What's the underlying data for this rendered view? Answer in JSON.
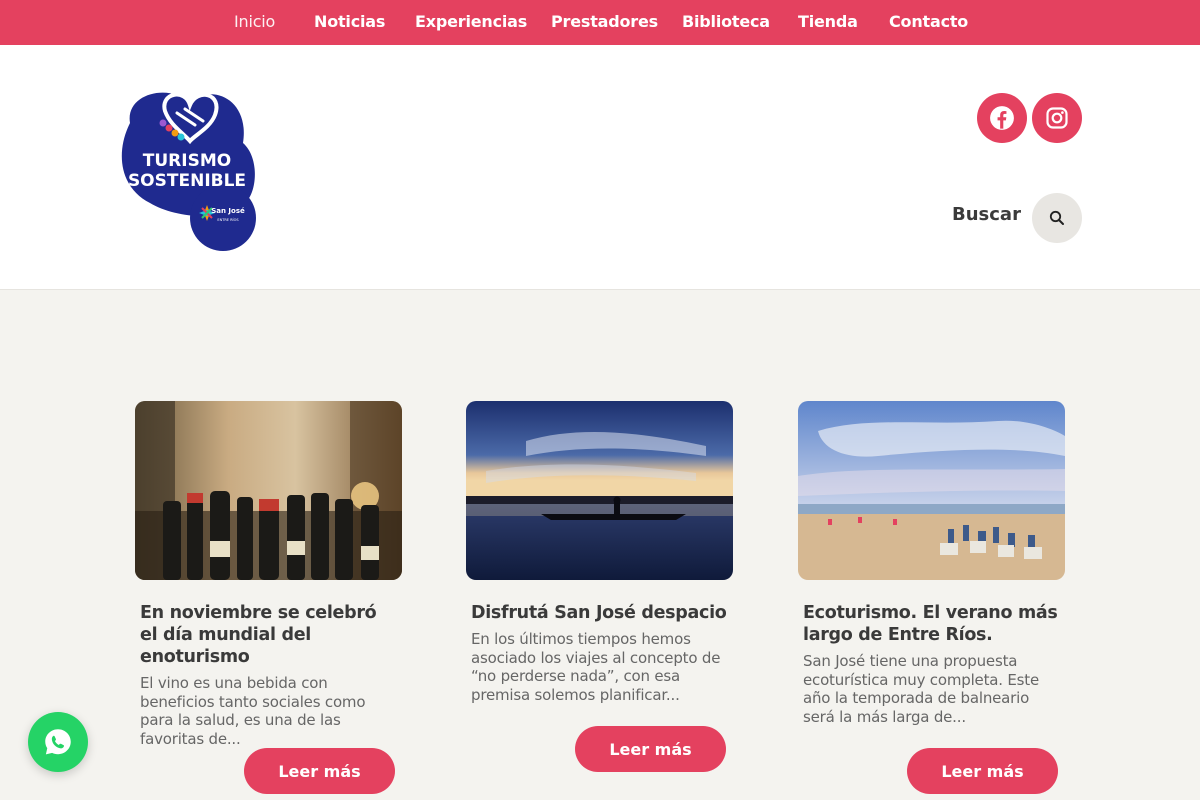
{
  "nav": {
    "items": [
      {
        "label": "Inicio"
      },
      {
        "label": "Noticias"
      },
      {
        "label": "Experiencias"
      },
      {
        "label": "Prestadores"
      },
      {
        "label": "Biblioteca"
      },
      {
        "label": "Tienda"
      },
      {
        "label": "Contacto"
      }
    ]
  },
  "header": {
    "logo": {
      "line1": "TURISMO",
      "line2": "SOSTENIBLE",
      "badge": "San José",
      "badge_sub": "ENTRE RÍOS"
    },
    "social": [
      {
        "icon": "facebook-icon"
      },
      {
        "icon": "instagram-icon"
      }
    ],
    "search_label": "Buscar",
    "search_icon": "search-icon"
  },
  "colors": {
    "accent": "#e4415f",
    "logo_blue": "#1f2a8f",
    "background": "#f4f3ef"
  },
  "cards": [
    {
      "title": "En noviembre se celebró el día mundial del enoturismo",
      "excerpt": "El vino es una bebida con beneficios tanto sociales como para la salud, es una de las favoritas de...",
      "button": "Leer más"
    },
    {
      "title": "Disfrutá San José despacio",
      "excerpt": "En los últimos tiempos hemos asociado los viajes al concepto de “no perderse nada”, con esa premisa solemos planificar...",
      "button": "Leer más"
    },
    {
      "title": "Ecoturismo. El verano más largo de Entre Ríos.",
      "excerpt": "San José tiene una propuesta ecoturística muy completa. Este año la temporada de balneario será la más larga de...",
      "button": "Leer más"
    }
  ],
  "whatsapp": {
    "icon": "whatsapp-icon"
  }
}
